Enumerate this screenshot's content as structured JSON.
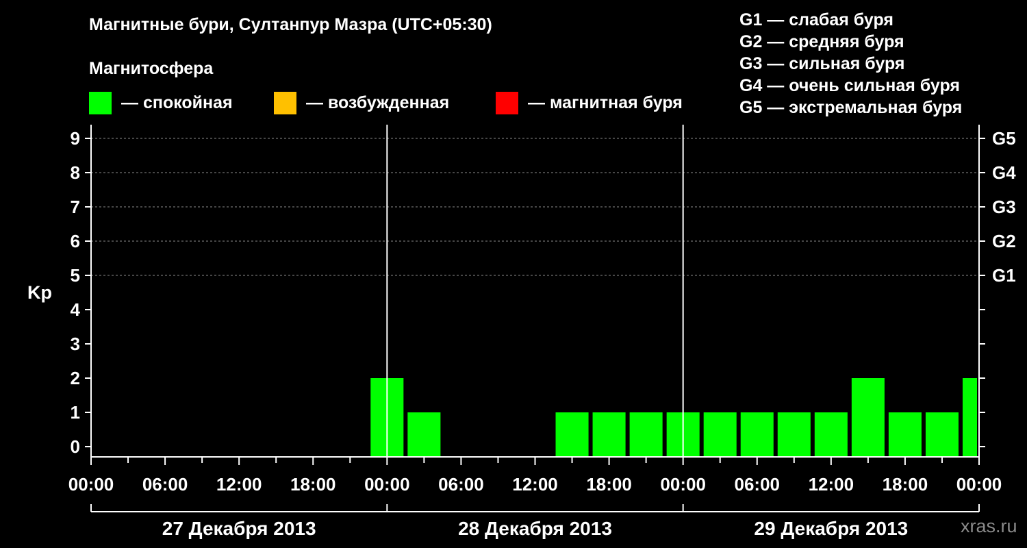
{
  "title": "Магнитные бури, Султанпур Мазра (UTC+05:30)",
  "legend": {
    "heading": "Магнитосфера",
    "items": [
      {
        "label": "— спокойная",
        "color": "#00ff00"
      },
      {
        "label": "— возбужденная",
        "color": "#ffc000"
      },
      {
        "label": "— магнитная буря",
        "color": "#ff0000"
      }
    ]
  },
  "storm_levels": [
    "G1 — слабая буря",
    "G2 — средняя буря",
    "G3 — сильная буря",
    "G4 — очень сильная буря",
    "G5 — экстремальная буря"
  ],
  "watermark": "xras.ru",
  "chart_data": {
    "type": "bar",
    "ylabel": "Kp",
    "ylim": [
      0,
      9
    ],
    "yticks": [
      0,
      1,
      2,
      3,
      4,
      5,
      6,
      7,
      8,
      9
    ],
    "right_ticks": [
      {
        "kp": 5,
        "label": "G1"
      },
      {
        "kp": 6,
        "label": "G2"
      },
      {
        "kp": 7,
        "label": "G3"
      },
      {
        "kp": 8,
        "label": "G4"
      },
      {
        "kp": 9,
        "label": "G5"
      }
    ],
    "grid": "dashed horizontal lines at Kp 5–9",
    "x_tick_labels": [
      "00:00",
      "06:00",
      "12:00",
      "18:00",
      "00:00",
      "06:00",
      "12:00",
      "18:00",
      "00:00",
      "06:00",
      "12:00",
      "18:00",
      "00:00"
    ],
    "days": [
      "27 Декабря 2013",
      "28 Декабря 2013",
      "29 Декабря 2013"
    ],
    "bar_color": "#00ff00",
    "bars": [
      {
        "start": "2013-12-27 22:30",
        "end": "2013-12-28 01:30",
        "kp": 2
      },
      {
        "start": "2013-12-28 01:30",
        "end": "2013-12-28 04:30",
        "kp": 1
      },
      {
        "start": "2013-12-28 13:30",
        "end": "2013-12-28 16:30",
        "kp": 1
      },
      {
        "start": "2013-12-28 16:30",
        "end": "2013-12-28 19:30",
        "kp": 1
      },
      {
        "start": "2013-12-28 19:30",
        "end": "2013-12-28 22:30",
        "kp": 1
      },
      {
        "start": "2013-12-28 22:30",
        "end": "2013-12-29 01:30",
        "kp": 1
      },
      {
        "start": "2013-12-29 01:30",
        "end": "2013-12-29 04:30",
        "kp": 1
      },
      {
        "start": "2013-12-29 04:30",
        "end": "2013-12-29 07:30",
        "kp": 1
      },
      {
        "start": "2013-12-29 07:30",
        "end": "2013-12-29 10:30",
        "kp": 1
      },
      {
        "start": "2013-12-29 10:30",
        "end": "2013-12-29 13:30",
        "kp": 1
      },
      {
        "start": "2013-12-29 13:30",
        "end": "2013-12-29 16:30",
        "kp": 2
      },
      {
        "start": "2013-12-29 16:30",
        "end": "2013-12-29 19:30",
        "kp": 1
      },
      {
        "start": "2013-12-29 19:30",
        "end": "2013-12-29 22:30",
        "kp": 1
      },
      {
        "start": "2013-12-29 22:30",
        "end": "2013-12-30 00:00",
        "kp": 2
      }
    ]
  }
}
